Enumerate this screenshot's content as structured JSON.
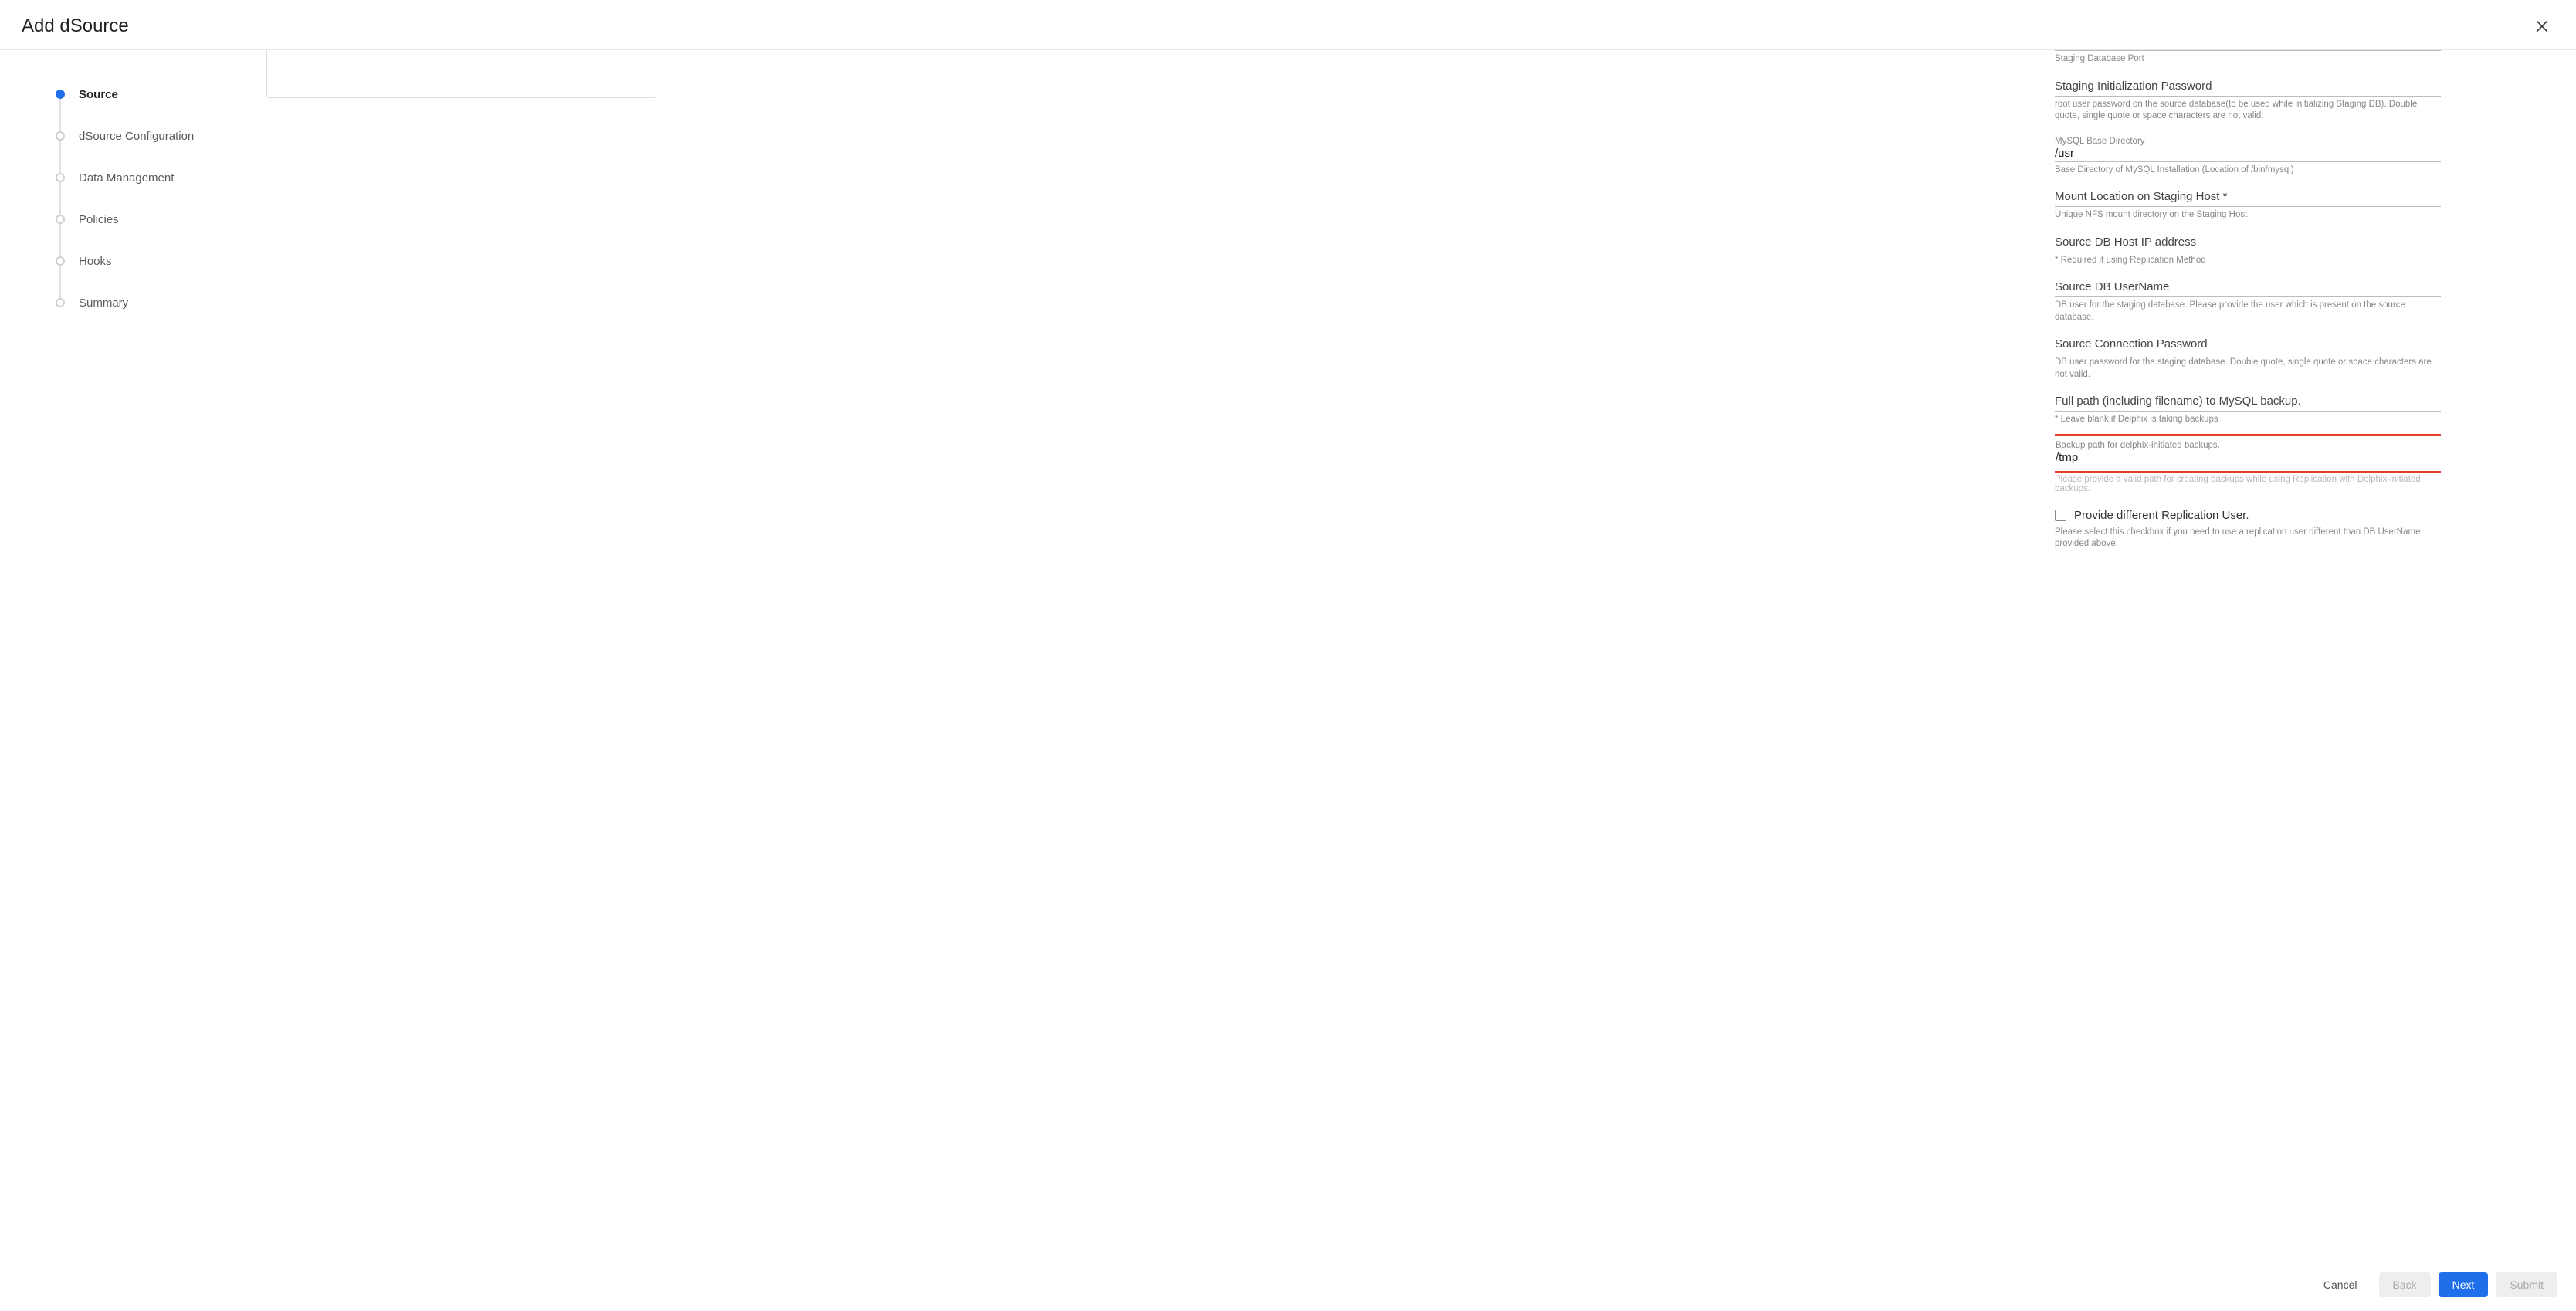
{
  "dialog": {
    "title": "Add dSource"
  },
  "stepper": {
    "steps": [
      {
        "label": "Source",
        "active": true
      },
      {
        "label": "dSource Configuration",
        "active": false
      },
      {
        "label": "Data Management",
        "active": false
      },
      {
        "label": "Policies",
        "active": false
      },
      {
        "label": "Hooks",
        "active": false
      },
      {
        "label": "Summary",
        "active": false
      }
    ]
  },
  "form": {
    "staging_port": {
      "helper": "Staging Database Port"
    },
    "staging_init_pw": {
      "label": "Staging Initialization Password",
      "helper": "root user password on the source database(to be used while initializing Staging DB). Double quote, single quote or space characters are not valid."
    },
    "mysql_base_dir": {
      "small_label": "MySQL Base Directory",
      "value": "/usr",
      "helper": "Base Directory of MySQL Installation (Location of /bin/mysql)"
    },
    "mount_location": {
      "label": "Mount Location on Staging Host *",
      "helper": "Unique NFS mount directory on the Staging Host"
    },
    "source_ip": {
      "label": "Source DB Host IP address",
      "helper": "* Required if using Replication Method"
    },
    "source_user": {
      "label": "Source DB UserName",
      "helper": "DB user for the staging database. Please provide the user which is present on the source database."
    },
    "source_conn_pw": {
      "label": "Source Connection Password",
      "helper": "DB user password for the staging database. Double quote, single quote or space characters are not valid."
    },
    "backup_full_path": {
      "label": "Full path (including filename) to MySQL backup.",
      "helper": "* Leave blank if Delphix is taking backups"
    },
    "backup_delphix_path": {
      "small_label": "Backup path for delphix-initiated backups.",
      "value": "/tmp",
      "obscured_helper": "Please provide a valid path for creating backups while using Replication with Delphix-initiated backups."
    },
    "replication_user_checkbox": {
      "label": "Provide different Replication User.",
      "helper": "Please select this checkbox if you need to use a replication user different than DB UserName provided above."
    }
  },
  "footer": {
    "cancel": "Cancel",
    "back": "Back",
    "next": "Next",
    "submit": "Submit"
  }
}
